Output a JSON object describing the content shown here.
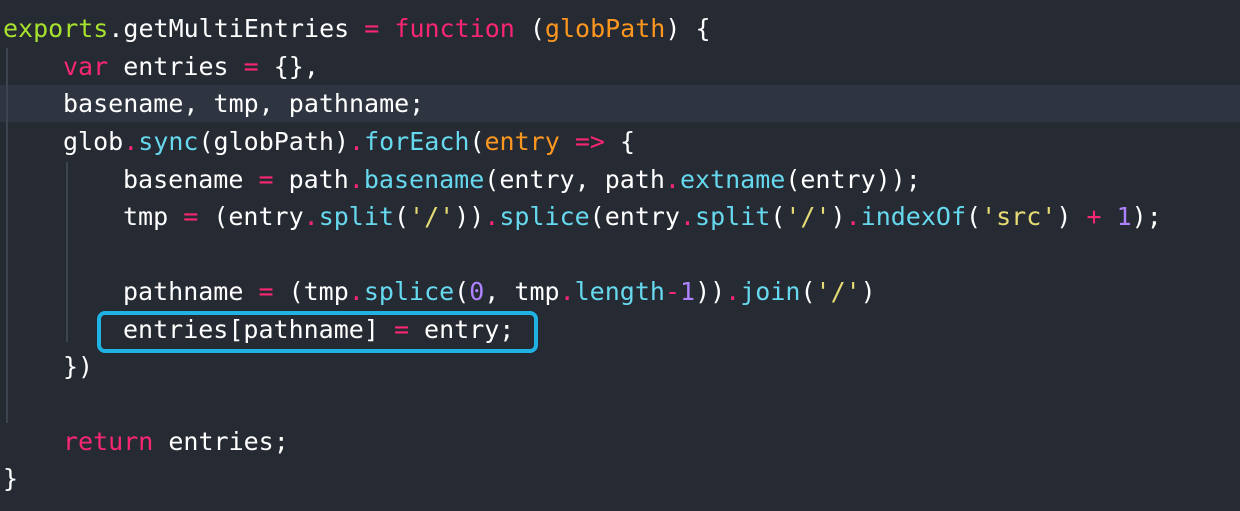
{
  "colors": {
    "background": "#262a33",
    "current_line": "#2f3540",
    "selection_box": "#1fb2e3",
    "keyword": "#f92672",
    "parameter": "#fd971f",
    "method": "#66d9ef",
    "string": "#e6db74",
    "number": "#ae81ff",
    "text": "#ffffff"
  },
  "code_lines": [
    {
      "tokens": [
        {
          "t": "exports",
          "c": "t-fnname"
        },
        {
          "t": ".",
          "c": "t-punc"
        },
        {
          "t": "getMultiEntries",
          "c": "t-ident"
        },
        {
          "t": " ",
          "c": "t-punc"
        },
        {
          "t": "=",
          "c": "t-op"
        },
        {
          "t": " ",
          "c": "t-punc"
        },
        {
          "t": "function",
          "c": "t-storage"
        },
        {
          "t": " (",
          "c": "t-punc"
        },
        {
          "t": "globPath",
          "c": "t-param"
        },
        {
          "t": ") {",
          "c": "t-punc"
        }
      ]
    },
    {
      "tokens": [
        {
          "t": "var",
          "c": "t-storage"
        },
        {
          "t": " entries ",
          "c": "t-ident"
        },
        {
          "t": "=",
          "c": "t-op"
        },
        {
          "t": " {},",
          "c": "t-punc"
        }
      ]
    },
    {
      "tokens": [
        {
          "t": "basename, tmp, pathname;",
          "c": "t-ident"
        }
      ]
    },
    {
      "tokens": [
        {
          "t": "glob",
          "c": "t-ident"
        },
        {
          "t": ".",
          "c": "t-dot"
        },
        {
          "t": "sync",
          "c": "t-fn-call"
        },
        {
          "t": "(globPath)",
          "c": "t-punc"
        },
        {
          "t": ".",
          "c": "t-dot"
        },
        {
          "t": "forEach",
          "c": "t-fn-call"
        },
        {
          "t": "(",
          "c": "t-punc"
        },
        {
          "t": "entry",
          "c": "t-param"
        },
        {
          "t": " ",
          "c": "t-punc"
        },
        {
          "t": "=>",
          "c": "t-storage"
        },
        {
          "t": " {",
          "c": "t-punc"
        }
      ]
    },
    {
      "tokens": [
        {
          "t": "basename ",
          "c": "t-ident"
        },
        {
          "t": "=",
          "c": "t-op"
        },
        {
          "t": " path",
          "c": "t-ident"
        },
        {
          "t": ".",
          "c": "t-dot"
        },
        {
          "t": "basename",
          "c": "t-fn-call"
        },
        {
          "t": "(entry, path",
          "c": "t-punc"
        },
        {
          "t": ".",
          "c": "t-dot"
        },
        {
          "t": "extname",
          "c": "t-fn-call"
        },
        {
          "t": "(entry));",
          "c": "t-punc"
        }
      ]
    },
    {
      "tokens": [
        {
          "t": "tmp ",
          "c": "t-ident"
        },
        {
          "t": "=",
          "c": "t-op"
        },
        {
          "t": " (entry",
          "c": "t-punc"
        },
        {
          "t": ".",
          "c": "t-dot"
        },
        {
          "t": "split",
          "c": "t-fn-call"
        },
        {
          "t": "(",
          "c": "t-punc"
        },
        {
          "t": "'/'",
          "c": "t-str"
        },
        {
          "t": "))",
          "c": "t-punc"
        },
        {
          "t": ".",
          "c": "t-dot"
        },
        {
          "t": "splice",
          "c": "t-fn-call"
        },
        {
          "t": "(entry",
          "c": "t-punc"
        },
        {
          "t": ".",
          "c": "t-dot"
        },
        {
          "t": "split",
          "c": "t-fn-call"
        },
        {
          "t": "(",
          "c": "t-punc"
        },
        {
          "t": "'/'",
          "c": "t-str"
        },
        {
          "t": ")",
          "c": "t-punc"
        },
        {
          "t": ".",
          "c": "t-dot"
        },
        {
          "t": "indexOf",
          "c": "t-fn-call"
        },
        {
          "t": "(",
          "c": "t-punc"
        },
        {
          "t": "'src'",
          "c": "t-str"
        },
        {
          "t": ") ",
          "c": "t-punc"
        },
        {
          "t": "+",
          "c": "t-op"
        },
        {
          "t": " ",
          "c": "t-punc"
        },
        {
          "t": "1",
          "c": "t-num"
        },
        {
          "t": ");",
          "c": "t-punc"
        }
      ]
    },
    {
      "tokens": []
    },
    {
      "tokens": [
        {
          "t": "pathname ",
          "c": "t-ident"
        },
        {
          "t": "=",
          "c": "t-op"
        },
        {
          "t": " (tmp",
          "c": "t-punc"
        },
        {
          "t": ".",
          "c": "t-dot"
        },
        {
          "t": "splice",
          "c": "t-fn-call"
        },
        {
          "t": "(",
          "c": "t-punc"
        },
        {
          "t": "0",
          "c": "t-num"
        },
        {
          "t": ", tmp",
          "c": "t-punc"
        },
        {
          "t": ".",
          "c": "t-dot"
        },
        {
          "t": "length",
          "c": "t-fn-call"
        },
        {
          "t": "-",
          "c": "t-op"
        },
        {
          "t": "1",
          "c": "t-num"
        },
        {
          "t": "))",
          "c": "t-punc"
        },
        {
          "t": ".",
          "c": "t-dot"
        },
        {
          "t": "join",
          "c": "t-fn-call"
        },
        {
          "t": "(",
          "c": "t-punc"
        },
        {
          "t": "'/'",
          "c": "t-str"
        },
        {
          "t": ")",
          "c": "t-punc"
        }
      ]
    },
    {
      "tokens": [
        {
          "t": "entries[pathname] ",
          "c": "t-ident"
        },
        {
          "t": "=",
          "c": "t-op"
        },
        {
          "t": " entry;",
          "c": "t-ident"
        }
      ]
    },
    {
      "tokens": [
        {
          "t": "})",
          "c": "t-punc"
        }
      ]
    },
    {
      "tokens": []
    },
    {
      "tokens": [
        {
          "t": "return",
          "c": "t-storage"
        },
        {
          "t": " entries;",
          "c": "t-ident"
        }
      ]
    },
    {
      "tokens": [
        {
          "t": "}",
          "c": "t-punc"
        }
      ]
    }
  ]
}
